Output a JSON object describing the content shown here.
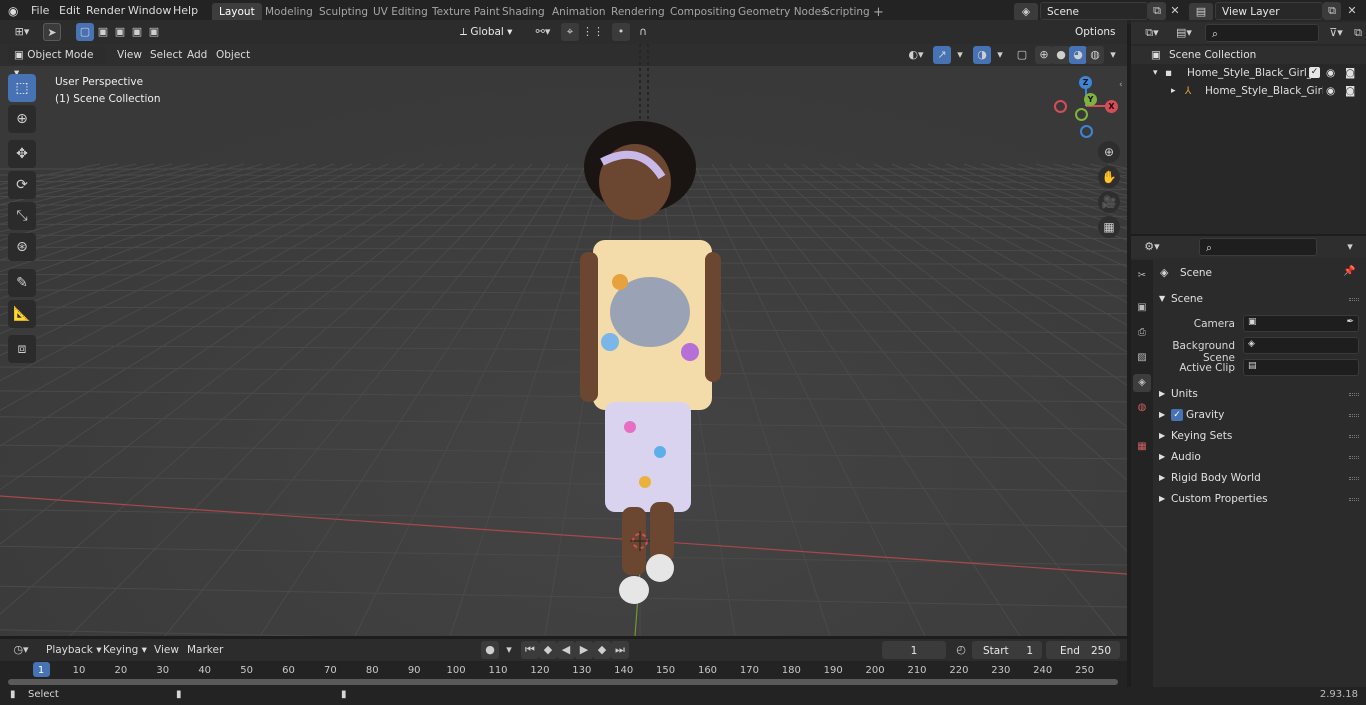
{
  "menubar": {
    "items": [
      "File",
      "Edit",
      "Render",
      "Window",
      "Help"
    ]
  },
  "workspaces": [
    "Layout",
    "Modeling",
    "Sculpting",
    "UV Editing",
    "Texture Paint",
    "Shading",
    "Animation",
    "Rendering",
    "Compositing",
    "Geometry Nodes",
    "Scripting"
  ],
  "active_workspace": "Layout",
  "scene_field": "Scene",
  "view_layer_field": "View Layer",
  "viewport_header": {
    "mode": "Object Mode",
    "menus": [
      "View",
      "Select",
      "Add",
      "Object"
    ],
    "transform_orientation": "Global",
    "options": "Options"
  },
  "viewport_overlay": {
    "perspective": "User Perspective",
    "collection": "(1) Scene Collection"
  },
  "gizmo_axes": {
    "x": "X",
    "y": "Y",
    "z": "Z"
  },
  "outliner": {
    "root": "Scene Collection",
    "items": [
      {
        "label": "Home_Style_Black_Girl_Child_"
      },
      {
        "label": "Home_Style_Black_Girl_C"
      }
    ]
  },
  "properties": {
    "context": "Scene",
    "panel": "Scene",
    "fields": [
      {
        "label": "Camera"
      },
      {
        "label": "Background Scene"
      },
      {
        "label": "Active Clip"
      }
    ],
    "subpanels": [
      "Units",
      "Gravity",
      "Keying Sets",
      "Audio",
      "Rigid Body World",
      "Custom Properties"
    ]
  },
  "timeline": {
    "menus": [
      "Playback",
      "Keying",
      "View",
      "Marker"
    ],
    "current_frame": "1",
    "start_label": "Start",
    "start_value": "1",
    "end_label": "End",
    "end_value": "250",
    "ticks": [
      "1",
      "10",
      "20",
      "30",
      "40",
      "50",
      "60",
      "70",
      "80",
      "90",
      "100",
      "110",
      "120",
      "130",
      "140",
      "150",
      "160",
      "170",
      "180",
      "190",
      "200",
      "210",
      "220",
      "230",
      "240",
      "250"
    ]
  },
  "statusbar": {
    "left": "Select",
    "version": "2.93.18"
  },
  "colors": {
    "accent": "#4772b3",
    "x_axis": "#d64c57",
    "y_axis": "#7eb33d",
    "z_axis": "#3d86d6"
  }
}
